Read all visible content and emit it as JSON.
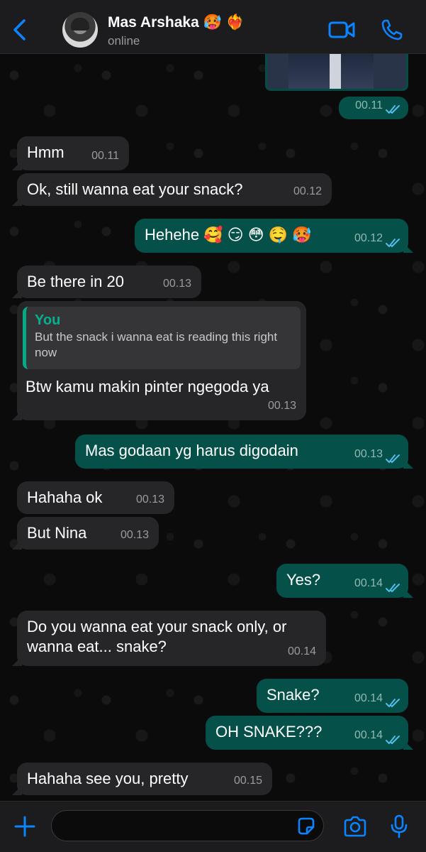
{
  "header": {
    "contact_name": "Mas Arshaka 🥵 ❤️‍🔥",
    "status": "online"
  },
  "messages": [
    {
      "dir": "out",
      "text": "",
      "time": "00.11",
      "read": true,
      "kind": "image"
    },
    {
      "dir": "in",
      "text": "Hmm",
      "time": "00.11"
    },
    {
      "dir": "in",
      "text": "Ok, still wanna eat your snack?",
      "time": "00.12"
    },
    {
      "dir": "out",
      "text": "Hehehe 🥰 😏 😳 🤤 🥵",
      "time": "00.12",
      "read": true
    },
    {
      "dir": "in",
      "text": "Be there in 20",
      "time": "00.13"
    },
    {
      "dir": "in",
      "text": "Btw kamu makin pinter ngegoda ya",
      "time": "00.13",
      "quote": {
        "author": "You",
        "text": "But the snack i wanna eat is reading this right now"
      }
    },
    {
      "dir": "out",
      "text": "Mas godaan yg harus digodain",
      "time": "00.13",
      "read": true
    },
    {
      "dir": "in",
      "text": "Hahaha ok",
      "time": "00.13"
    },
    {
      "dir": "in",
      "text": "But Nina",
      "time": "00.13"
    },
    {
      "dir": "out",
      "text": "Yes?",
      "time": "00.14",
      "read": true
    },
    {
      "dir": "in",
      "text": "Do you wanna eat your snack only, or wanna eat... snake?",
      "time": "00.14"
    },
    {
      "dir": "out",
      "text": "Snake?",
      "time": "00.14",
      "read": true
    },
    {
      "dir": "out",
      "text": "OH SNAKE???",
      "time": "00.14",
      "read": true
    },
    {
      "dir": "in",
      "text": "Hahaha see you, pretty",
      "time": "00.15"
    }
  ],
  "composer": {
    "value": "",
    "placeholder": ""
  },
  "colors": {
    "accent": "#0a84ff",
    "incoming_bubble": "#262628",
    "outgoing_bubble": "#055048",
    "read_ticks": "#53bdeb",
    "quote_bar": "#07a884"
  },
  "icons": [
    "back-chevron-icon",
    "video-call-icon",
    "phone-call-icon",
    "plus-icon",
    "sticker-icon",
    "camera-icon",
    "microphone-icon"
  ]
}
